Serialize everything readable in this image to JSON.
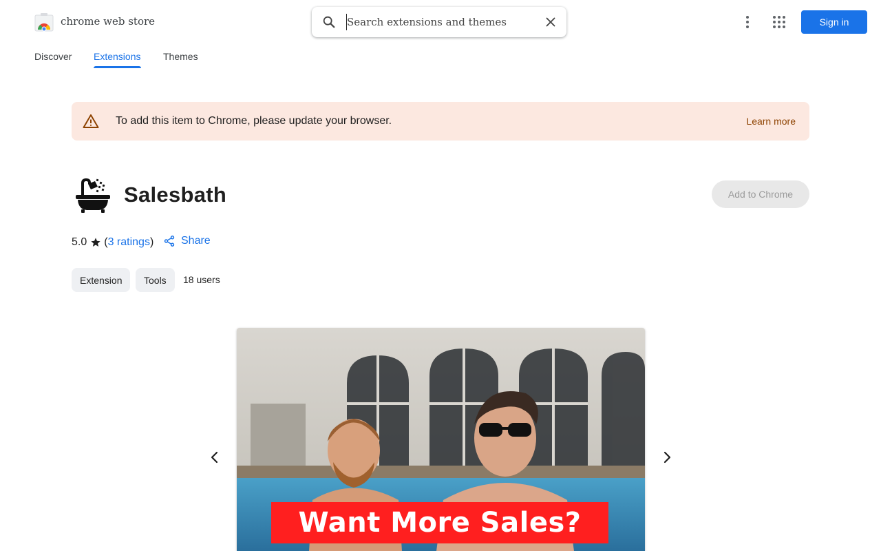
{
  "header": {
    "store_name": "chrome web store",
    "search_placeholder": "Search extensions and themes",
    "sign_in_label": "Sign in",
    "icons": [
      "chrome-web-store-logo",
      "search-icon",
      "close-icon",
      "more-vert-icon",
      "apps-grid-icon"
    ]
  },
  "nav": {
    "tabs": [
      {
        "label": "Discover",
        "active": false
      },
      {
        "label": "Extensions",
        "active": true
      },
      {
        "label": "Themes",
        "active": false
      }
    ]
  },
  "banner": {
    "message": "To add this item to Chrome, please update your browser.",
    "link_label": "Learn more",
    "icon": "warning-icon",
    "background": "#fce8e0",
    "link_color": "#8d4200"
  },
  "extension": {
    "name": "Salesbath",
    "add_label": "Add to Chrome",
    "rating": "5.0",
    "ratings_count_label": "3 ratings",
    "share_label": "Share",
    "chips": [
      "Extension",
      "Tools"
    ],
    "users": "18 users",
    "icon": "bathtub-shower-icon"
  },
  "carousel": {
    "slide_caption": "Want More Sales?",
    "icons": [
      "chevron-left-icon",
      "chevron-right-icon"
    ]
  },
  "colors": {
    "accent": "#1a73e8",
    "text": "#1f1f1f",
    "chip_bg": "#eef0f3",
    "disabled_btn_bg": "#e8e8e8",
    "promo_red": "#ff1f1f"
  }
}
